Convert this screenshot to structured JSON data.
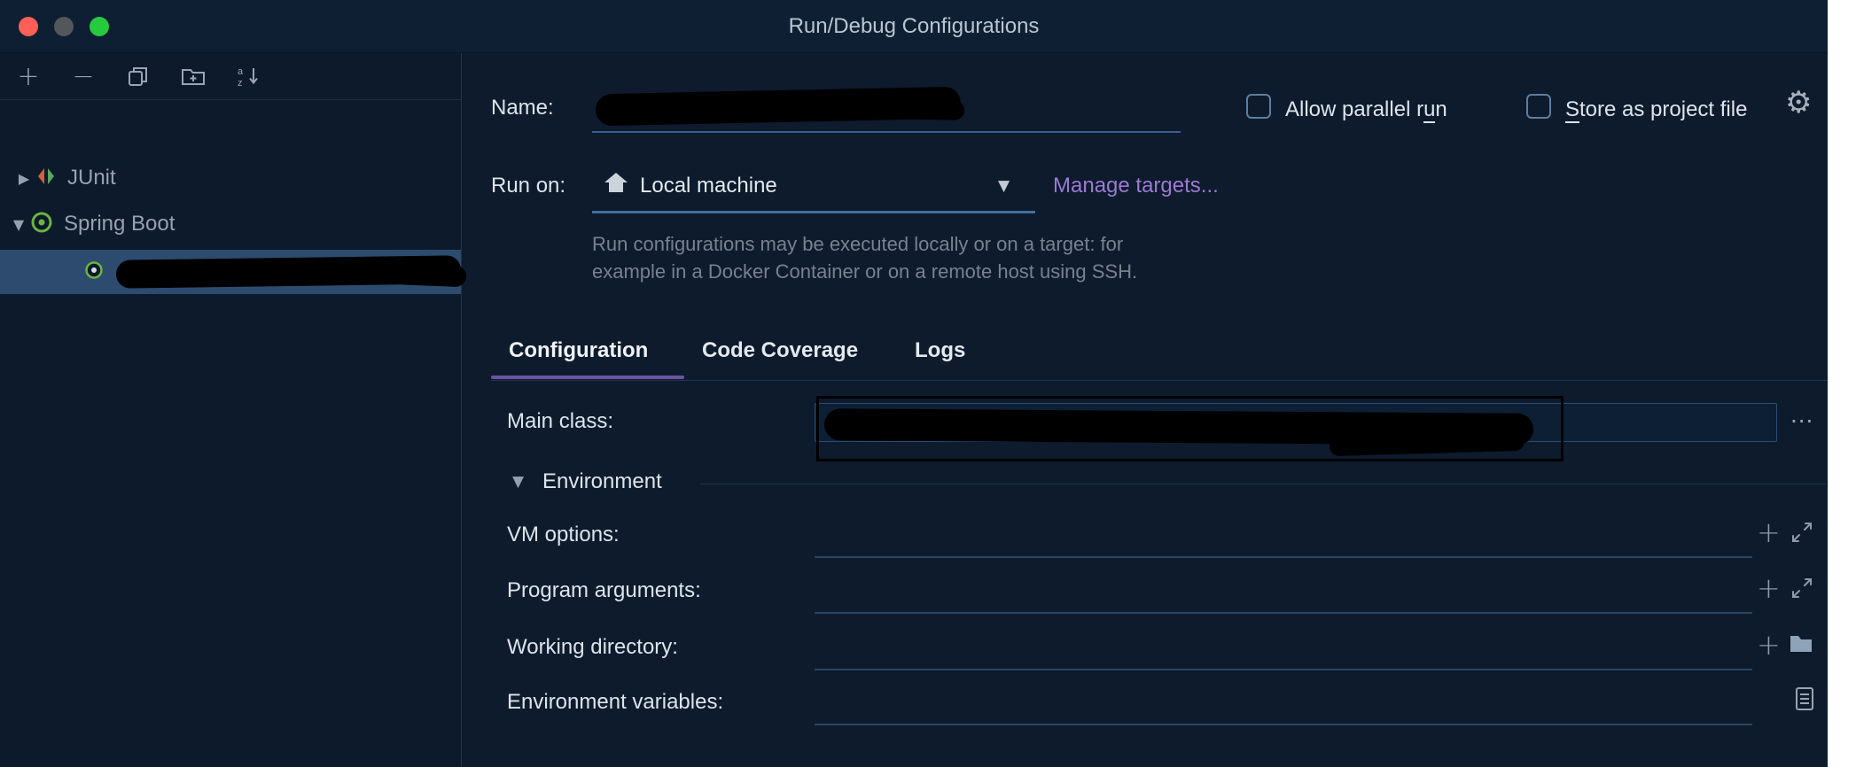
{
  "window": {
    "title": "Run/Debug Configurations"
  },
  "sidebar": {
    "tree": {
      "junit_label": "JUnit",
      "spring_boot_label": "Spring Boot"
    }
  },
  "form": {
    "name_label": "Name:",
    "allow_parallel_run": {
      "pre": "Allow parallel r",
      "mnemonic": "u",
      "post": "n"
    },
    "store_as_project_file": {
      "mnemonic": "S",
      "post": "tore as project file"
    },
    "run_on_label": "Run on:",
    "run_on_value": "Local machine",
    "manage_targets_link": "Manage targets...",
    "run_on_help_line1": "Run configurations may be executed locally or on a target: for",
    "run_on_help_line2": "example in a Docker Container or on a remote host using SSH.",
    "tabs": [
      {
        "label": "Configuration",
        "selected": true
      },
      {
        "label": "Code Coverage",
        "selected": false
      },
      {
        "label": "Logs",
        "selected": false
      }
    ],
    "main_class_label": "Main class:",
    "browse_button": "...",
    "environment_section_label": "Environment",
    "vm_options_label": "VM options:",
    "program_arguments_label": "Program arguments:",
    "working_directory_label": "Working directory:",
    "environment_variables_label": "Environment variables:"
  },
  "colors": {
    "accent_link_purple": "#9b7ad1",
    "tab_underline_purple": "#6b52a5",
    "spring_green": "#6db33f",
    "selection_blue": "#2d4b6e",
    "window_background": "#0d1b2d"
  }
}
